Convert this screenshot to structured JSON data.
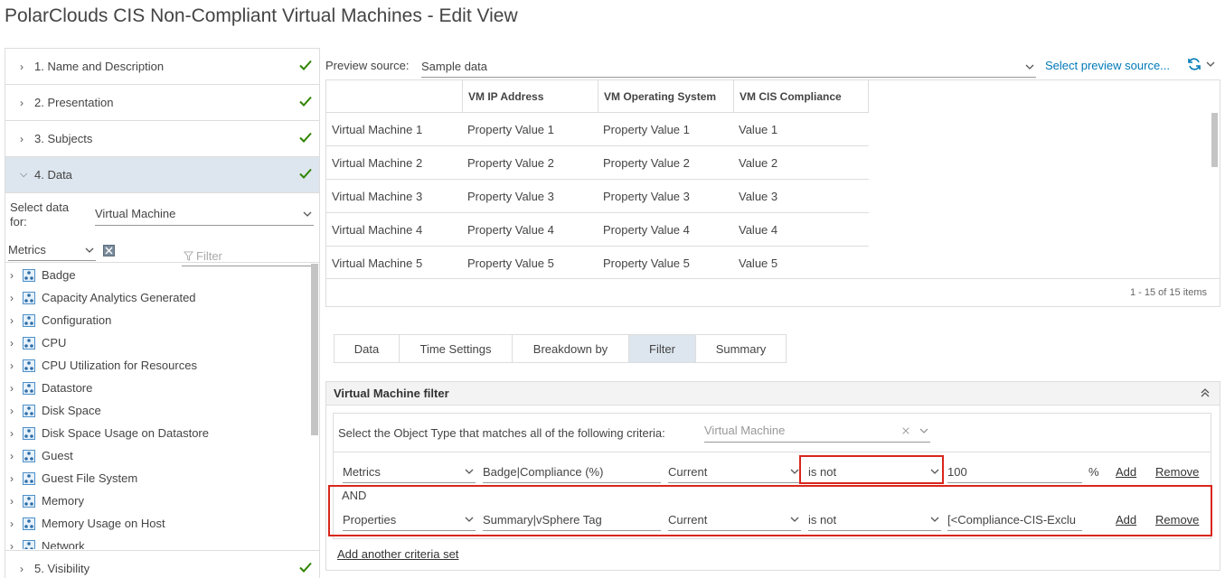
{
  "page_title": "PolarClouds CIS Non-Compliant Virtual Machines - Edit View",
  "steps": [
    {
      "label": "1. Name and Description",
      "complete": true,
      "expanded": false
    },
    {
      "label": "2. Presentation",
      "complete": true,
      "expanded": false
    },
    {
      "label": "3. Subjects",
      "complete": true,
      "expanded": false
    },
    {
      "label": "4. Data",
      "complete": true,
      "expanded": true
    },
    {
      "label": "5. Visibility",
      "complete": true,
      "expanded": false
    }
  ],
  "data_panel": {
    "select_data_label": "Select data for:",
    "select_data_value": "Virtual Machine",
    "metrics_value": "Metrics",
    "filter_placeholder": "Filter",
    "tree_items": [
      "Badge",
      "Capacity Analytics Generated",
      "Configuration",
      "CPU",
      "CPU Utilization for Resources",
      "Datastore",
      "Disk Space",
      "Disk Space Usage on Datastore",
      "Guest",
      "Guest File System",
      "Memory",
      "Memory Usage on Host",
      "Network"
    ]
  },
  "preview": {
    "source_label": "Preview source:",
    "source_value": "Sample data",
    "select_link": "Select preview source...",
    "columns": [
      "",
      "VM IP Address",
      "VM Operating System",
      "VM CIS Compliance"
    ],
    "rows": [
      [
        "Virtual Machine 1",
        "Property Value 1",
        "Property Value 1",
        "Value 1"
      ],
      [
        "Virtual Machine 2",
        "Property Value 2",
        "Property Value 2",
        "Value 2"
      ],
      [
        "Virtual Machine 3",
        "Property Value 3",
        "Property Value 3",
        "Value 3"
      ],
      [
        "Virtual Machine 4",
        "Property Value 4",
        "Property Value 4",
        "Value 4"
      ],
      [
        "Virtual Machine 5",
        "Property Value 5",
        "Property Value 5",
        "Value 5"
      ]
    ],
    "pagination": "1 - 15 of 15 items"
  },
  "tabs": [
    {
      "label": "Data",
      "active": false
    },
    {
      "label": "Time Settings",
      "active": false
    },
    {
      "label": "Breakdown by",
      "active": false
    },
    {
      "label": "Filter",
      "active": true
    },
    {
      "label": "Summary",
      "active": false
    }
  ],
  "filter": {
    "title": "Virtual Machine filter",
    "intro": "Select the Object Type that matches all of the following criteria:",
    "object_type_placeholder": "Virtual Machine",
    "and_label": "AND",
    "criteria": [
      {
        "type": "Metrics",
        "attribute": "Badge|Compliance (%)",
        "timing": "Current",
        "operator": "is not",
        "value": "100",
        "unit": "%",
        "add": "Add",
        "remove": "Remove"
      },
      {
        "type": "Properties",
        "attribute": "Summary|vSphere Tag",
        "timing": "Current",
        "operator": "is not",
        "value": "[<Compliance-CIS-Exclu",
        "unit": "",
        "add": "Add",
        "remove": "Remove"
      }
    ],
    "add_set": "Add another criteria set"
  },
  "colors": {
    "accent": "#0079b8",
    "check": "#2f8400",
    "active_bg": "#dde6ee",
    "highlight": "#d9261c"
  }
}
